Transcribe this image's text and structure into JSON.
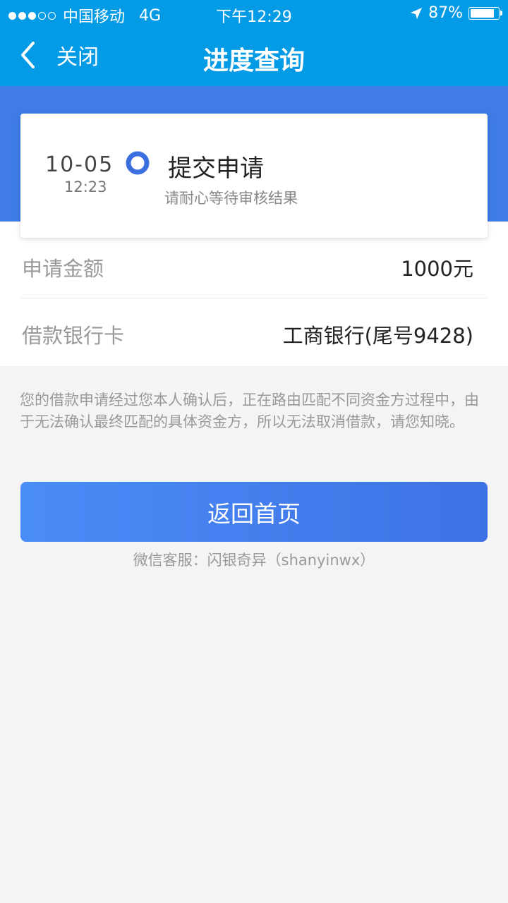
{
  "status_bar": {
    "signal_dots": [
      true,
      true,
      true,
      false,
      false
    ],
    "carrier": "中国移动",
    "network": "4G",
    "time": "下午12:29",
    "battery_percent": "87%",
    "battery_level": 0.87,
    "location_icon": "location-arrow-icon"
  },
  "nav": {
    "back_icon": "chevron-left-icon",
    "back_label": "关闭",
    "title": "进度查询"
  },
  "progress": {
    "date": "10-05",
    "time": "12:23",
    "status_icon": "radio-dot-icon",
    "status": "提交申请",
    "subtitle": "请耐心等待审核结果"
  },
  "details": {
    "amount_label": "申请金额",
    "amount_value": "1000元",
    "card_label": "借款银行卡",
    "card_value": "工商银行(尾号9428)"
  },
  "notice": "您的借款申请经过您本人确认后，正在路由匹配不同资金方过程中，由于无法确认最终匹配的具体资金方，所以无法取消借款，请您知晓。",
  "home_button": "返回首页",
  "service": "微信客服：闪银奇异（shanyinwx）",
  "colors": {
    "header": "#039be5",
    "band": "#3f7ce8",
    "accent": "#3b6fe0"
  }
}
